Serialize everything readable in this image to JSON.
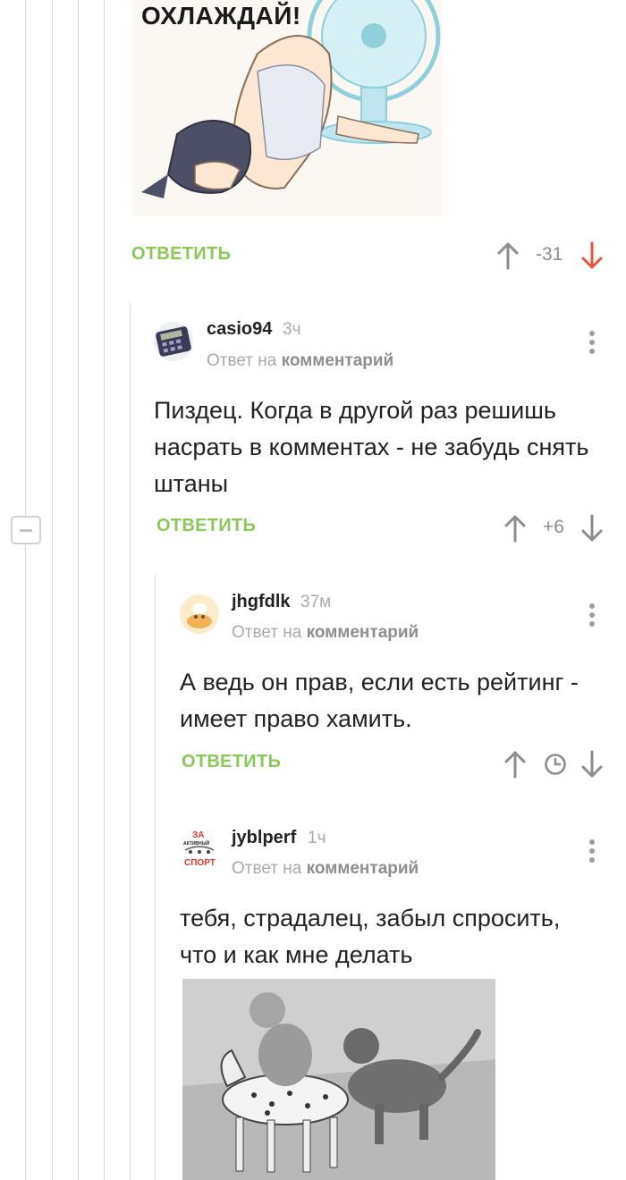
{
  "top_image": {
    "caption": "ОХЛАЖДАЙ!"
  },
  "comments": [
    {
      "reply_label": "ОТВЕТИТЬ",
      "rating": "-31"
    },
    {
      "username": "casio94",
      "time": "3ч",
      "reply_prefix": "Ответ на",
      "reply_link": "комментарий",
      "text": "Пиздец. Когда в другой раз решишь насрать в комментах - не забудь снять штаны",
      "reply_label": "ОТВЕТИТЬ",
      "rating": "+6"
    },
    {
      "username": "jhgfdlk",
      "time": "37м",
      "reply_prefix": "Ответ на",
      "reply_link": "комментарий",
      "text": "А ведь он прав, если есть рейтинг - имеет право хамить.",
      "reply_label": "ОТВЕТИТЬ"
    },
    {
      "username": "jyblperf",
      "time": "1ч",
      "reply_prefix": "Ответ на",
      "reply_link": "комментарий",
      "text": "тебя, страдалец, забыл спросить, что и как мне делать",
      "avatar_text": [
        "ЗА",
        "АКТИВНЫЙ",
        "СПОРТ"
      ]
    }
  ],
  "colors": {
    "reply_green": "#8ac858",
    "downvote_red": "#e8553a",
    "muted": "#a9a9a9"
  }
}
